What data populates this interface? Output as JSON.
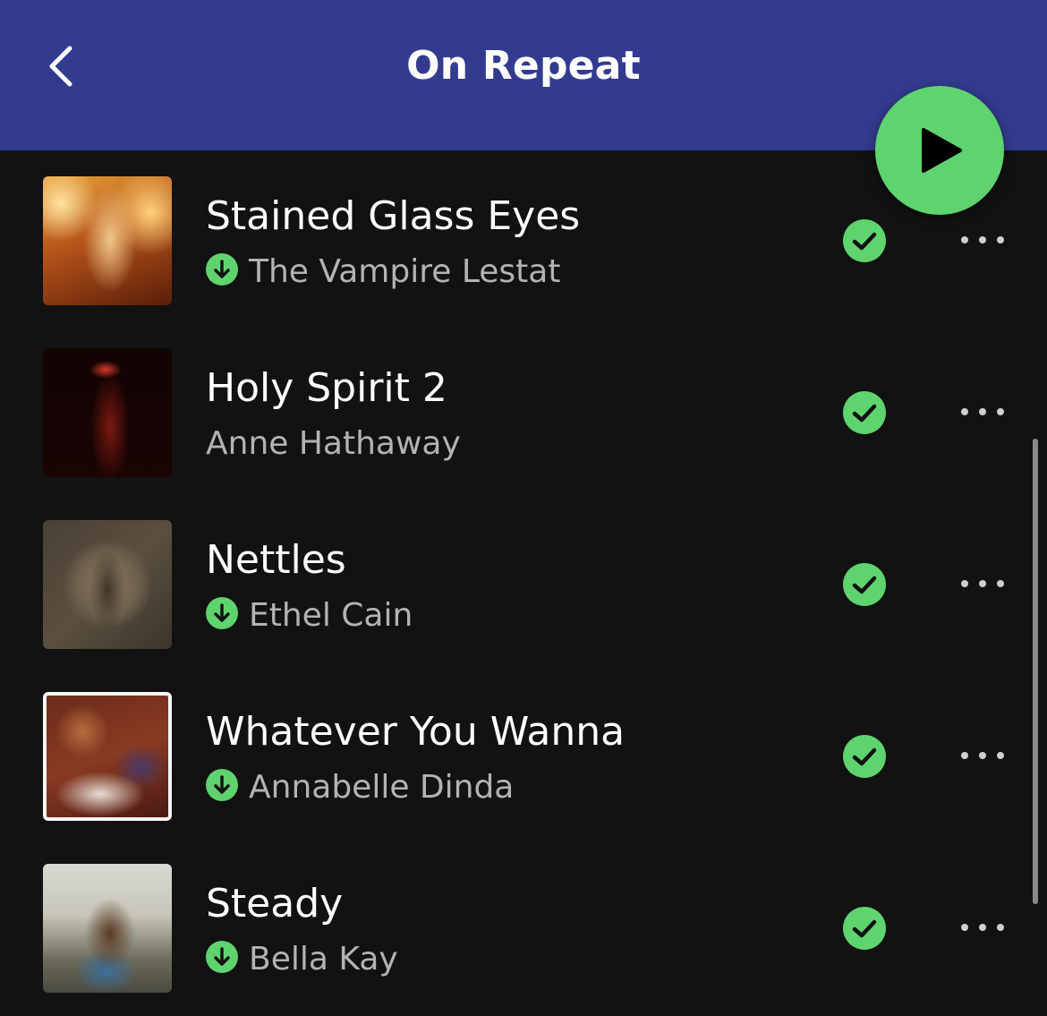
{
  "header": {
    "title": "On Repeat",
    "background_color": "#333b8f"
  },
  "accent_color": "#5fd36e",
  "icons": {
    "back": "chevron-left-icon",
    "play": "play-icon",
    "saved": "check-circle-icon",
    "download": "download-icon",
    "more": "more-horizontal-icon"
  },
  "tracks": [
    {
      "title": "Stained Glass Eyes",
      "artist": "The Vampire Lestat",
      "downloaded": true,
      "saved": true
    },
    {
      "title": "Holy Spirit 2",
      "artist": "Anne Hathaway",
      "downloaded": false,
      "saved": true
    },
    {
      "title": "Nettles",
      "artist": "Ethel Cain",
      "downloaded": true,
      "saved": true
    },
    {
      "title": "Whatever You Wanna",
      "artist": "Annabelle Dinda",
      "downloaded": true,
      "saved": true
    },
    {
      "title": "Steady",
      "artist": "Bella Kay",
      "downloaded": true,
      "saved": true
    }
  ]
}
